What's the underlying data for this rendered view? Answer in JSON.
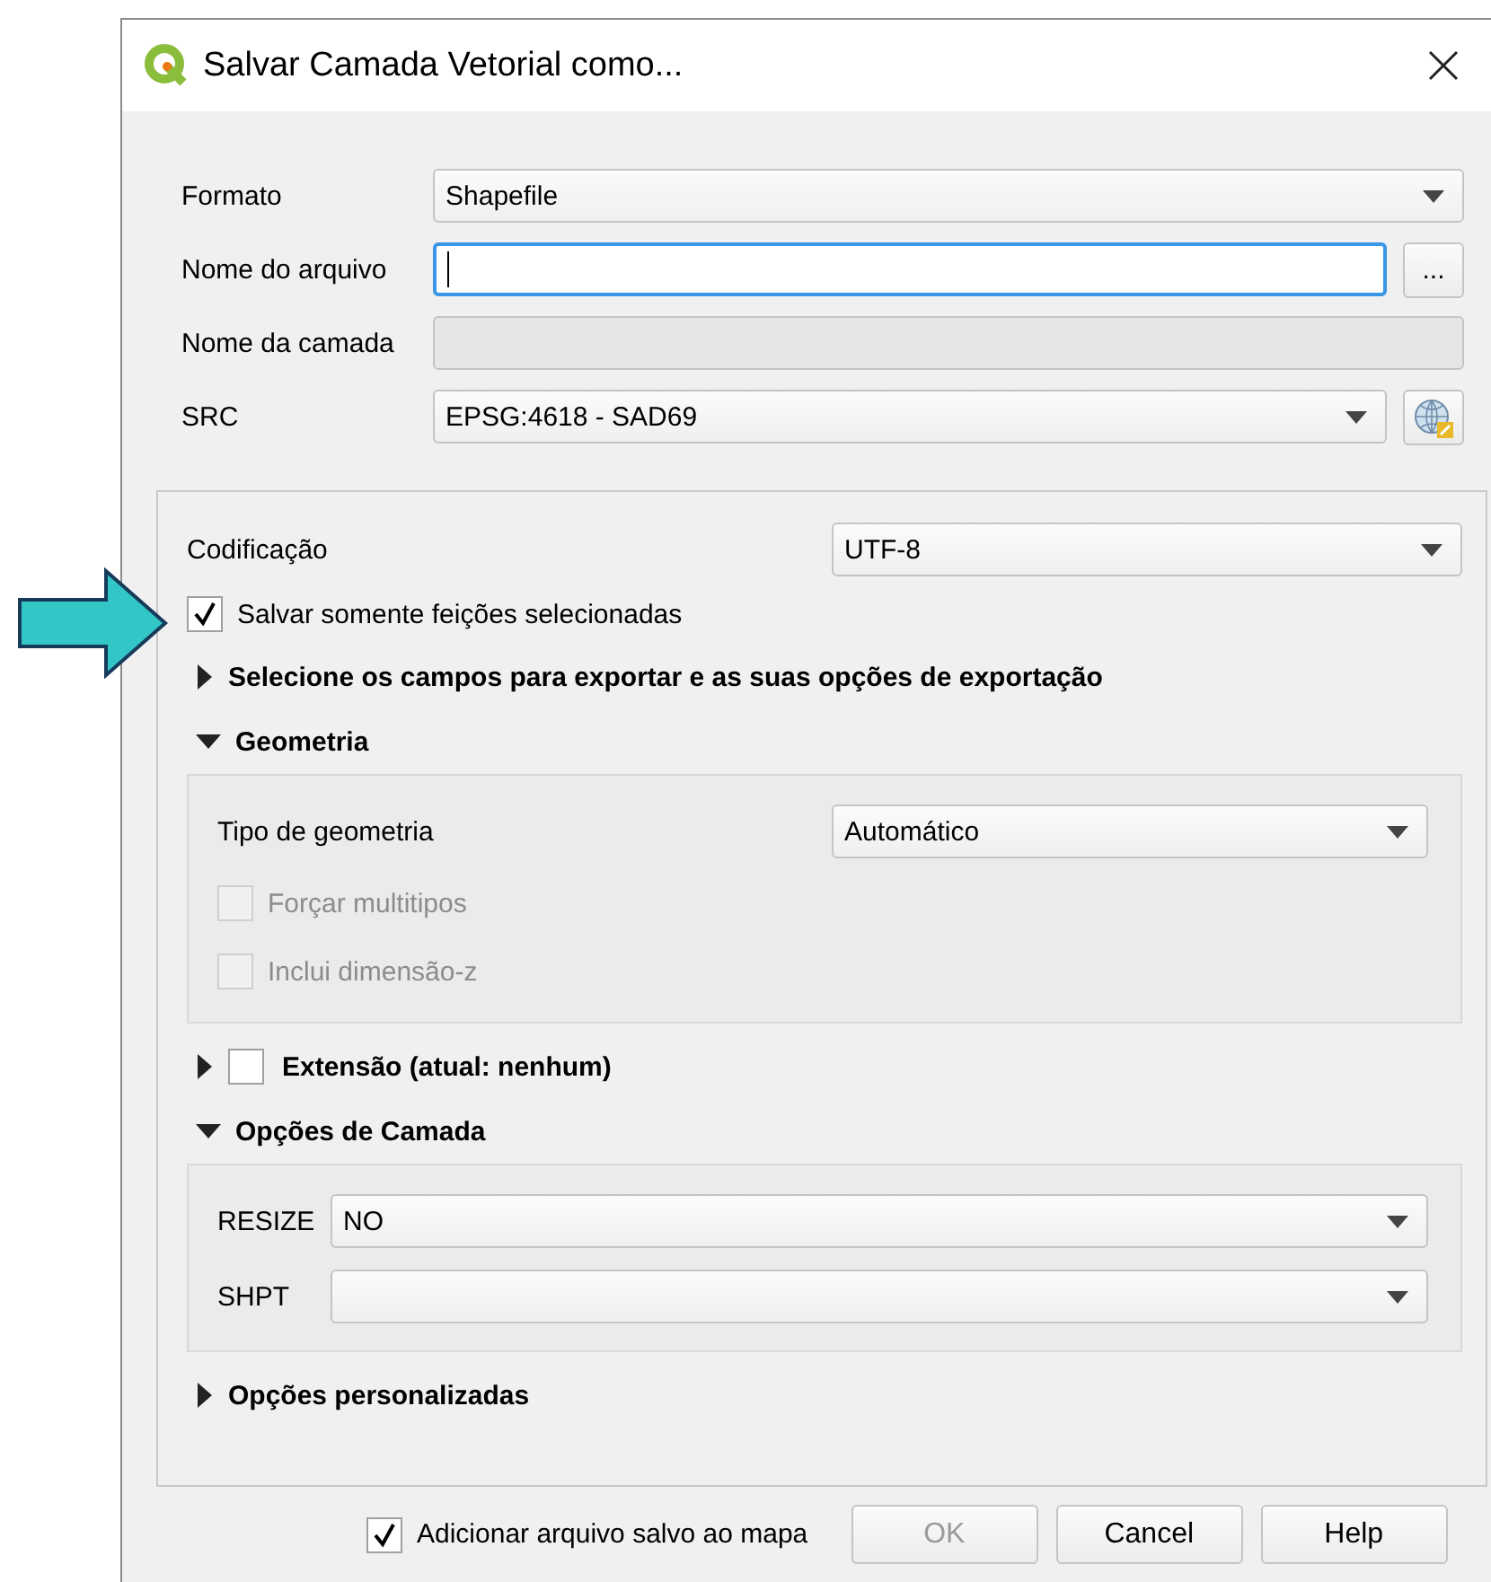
{
  "window": {
    "title": "Salvar Camada Vetorial como..."
  },
  "fields": [
    {
      "label": "Formato",
      "kind": "combo",
      "value": "Shapefile"
    },
    {
      "label": "Nome do arquivo",
      "kind": "file",
      "button": "...",
      "focused": true
    },
    {
      "label": "Nome da camada",
      "kind": "text",
      "disabled": true
    },
    {
      "label": "SRC",
      "kind": "crs",
      "value": "EPSG:4618 - SAD69"
    }
  ],
  "encoding": {
    "label": "Codificação",
    "value": "UTF-8"
  },
  "only_selected": {
    "label": "Salvar somente feições selecionadas",
    "checked": true
  },
  "sections": [
    {
      "title": "Selecione os campos para exportar e as suas opções de exportação",
      "kind": "plain",
      "expanded": false
    },
    {
      "title": "Geometria",
      "kind": "geometry",
      "expanded": true,
      "rows": [
        {
          "kind": "combo",
          "label": "Tipo de geometria",
          "value": "Automático"
        },
        {
          "kind": "checkbox",
          "label": "Forçar multitipos",
          "checked": false,
          "disabled": true
        },
        {
          "kind": "checkbox",
          "label": "Inclui dimensão-z",
          "checked": false,
          "disabled": true
        }
      ]
    },
    {
      "title": "Extensão (atual: nenhum)",
      "kind": "checkable",
      "expanded": false,
      "checked": false
    },
    {
      "title": "Opções de Camada",
      "kind": "options",
      "expanded": true,
      "rows": [
        {
          "kind": "combo",
          "label": "RESIZE",
          "value": "NO"
        },
        {
          "kind": "combo",
          "label": "SHPT"
        }
      ]
    },
    {
      "title": "Opções personalizadas",
      "kind": "plain",
      "expanded": false
    }
  ],
  "add_to_map": {
    "label": "Adicionar arquivo salvo ao mapa",
    "checked": true
  },
  "buttons": [
    {
      "label": "OK",
      "disabled": true
    },
    {
      "label": "Cancel",
      "disabled": false
    },
    {
      "label": "Help",
      "disabled": false
    }
  ]
}
